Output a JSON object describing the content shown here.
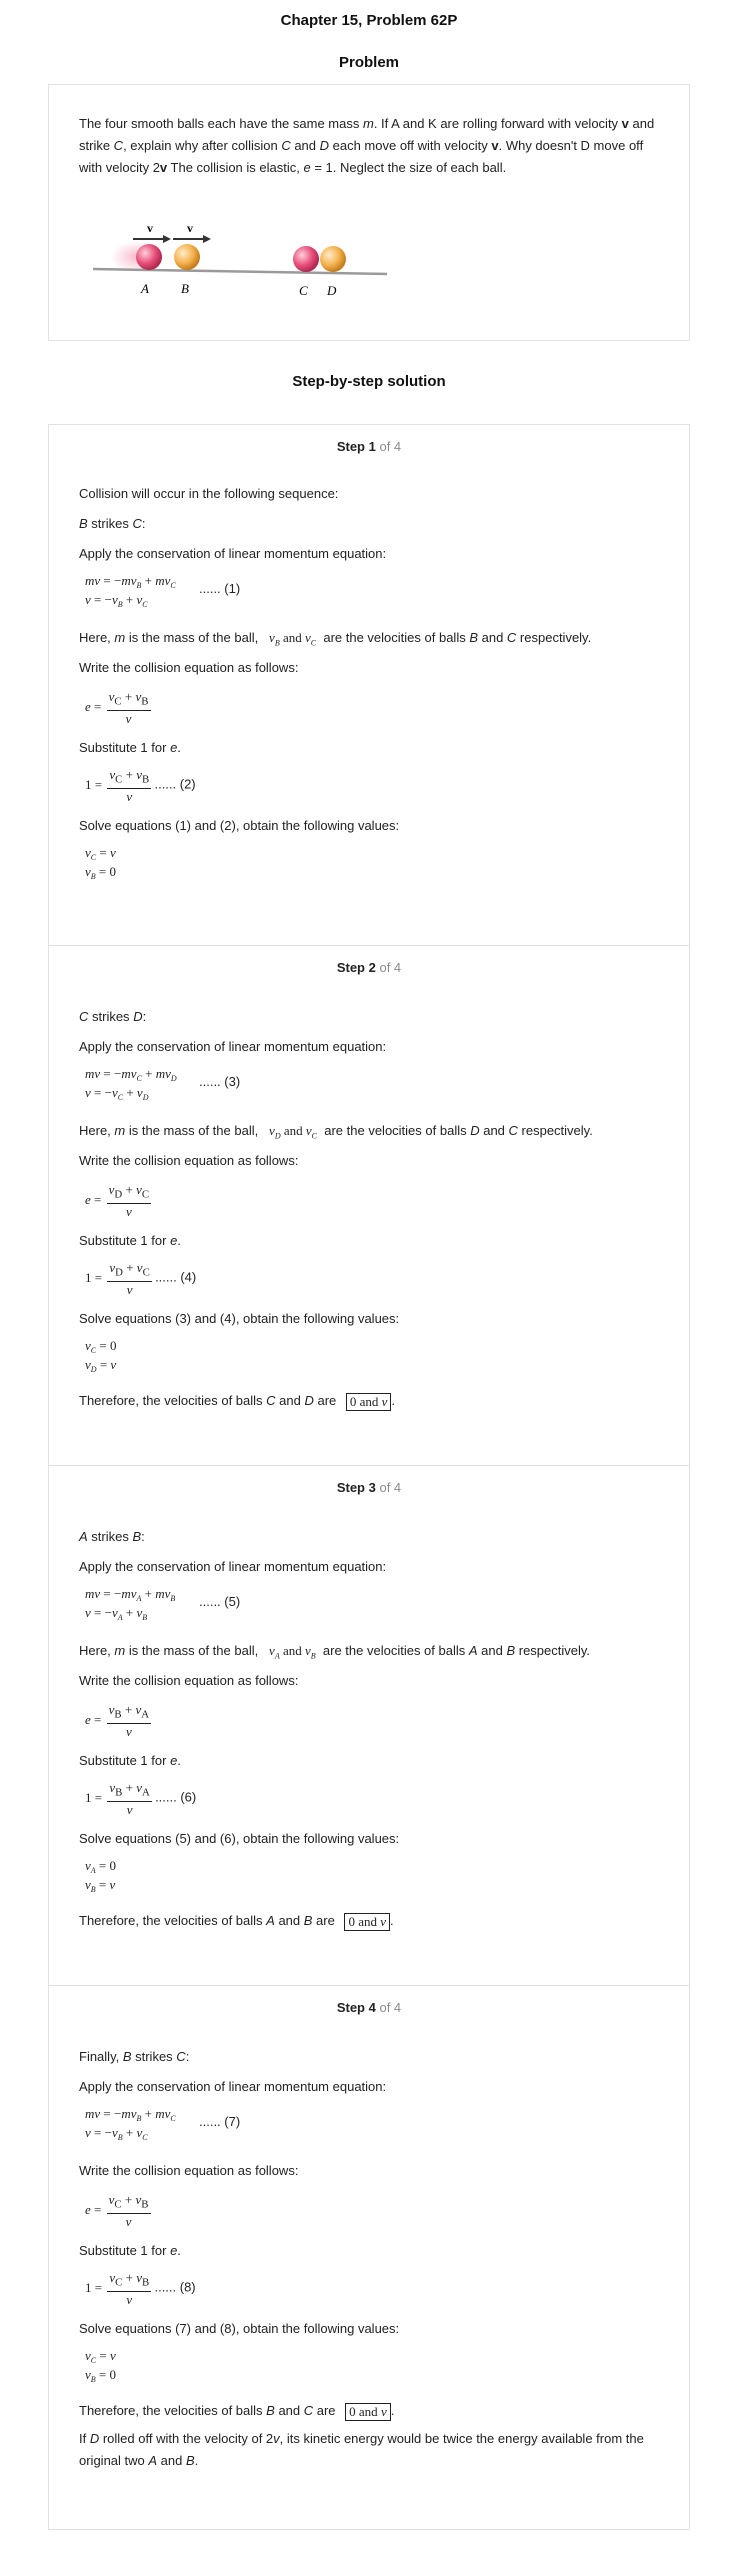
{
  "header": {
    "title": "Chapter 15, Problem 62P",
    "problem_heading": "Problem",
    "solution_heading": "Step-by-step solution"
  },
  "problem": {
    "text_html": "The four smooth balls each have the same mass <i>m</i>. If A and K are rolling forward with velocity <b>v</b> and strike <i>C</i>, explain why after collision <i>C</i> and <i>D</i> each move off with velocity <b>v</b>. Why doesn't D move off with velocity 2<b>v</b> The collision is elastic, <i>e</i> = 1. Neglect the size of each ball.",
    "figure": {
      "labels": [
        "v",
        "v",
        "A",
        "B",
        "C",
        "D"
      ],
      "colors": {
        "ball_a": "#e8507a",
        "ball_b": "#f5b24e",
        "ball_c": "#e8507a",
        "ball_d": "#f5b24e",
        "ground": "#9a9a9a"
      }
    }
  },
  "steps": [
    {
      "label": "Step 1",
      "of": "of 4",
      "lines": {
        "intro": "Collision will occur in the following sequence:",
        "strike": "B strikes C:",
        "momentum_intro": "Apply the conservation of linear momentum equation:",
        "here": "Here, m is the mass of the ball,   v_B and v_C  are the velocities of balls B and C respectively.",
        "collision_intro": "Write the collision equation as follows:",
        "substitute": "Substitute 1 for e.",
        "solve": "Solve equations (1) and (2), obtain the following values:"
      },
      "tags": {
        "eq1": "...... (1)",
        "eq2": "...... (2)"
      }
    },
    {
      "label": "Step 2",
      "of": "of 4",
      "lines": {
        "strike": "C strikes D:",
        "momentum_intro": "Apply the conservation of linear momentum equation:",
        "here": "Here, m is the mass of the ball,   v_D and v_C  are the velocities of balls D and C respectively.",
        "collision_intro": "Write the collision equation as follows:",
        "substitute": "Substitute 1 for e.",
        "solve": "Solve equations (3) and (4), obtain the following values:",
        "therefore": "Therefore, the velocities of balls C and D are",
        "answer": "0 and v"
      },
      "tags": {
        "eq1": "...... (3)",
        "eq2": "...... (4)"
      }
    },
    {
      "label": "Step 3",
      "of": "of 4",
      "lines": {
        "strike": "A strikes B:",
        "momentum_intro": "Apply the conservation of linear momentum equation:",
        "here": "Here, m is the mass of the ball,   v_A and v_B  are the velocities of balls A and B respectively.",
        "collision_intro": "Write the collision equation as follows:",
        "substitute": "Substitute 1 for e.",
        "solve": "Solve equations (5) and (6), obtain the following values:",
        "therefore": "Therefore, the velocities of balls A and B are",
        "answer": "0 and v"
      },
      "tags": {
        "eq1": "...... (5)",
        "eq2": "...... (6)"
      }
    },
    {
      "label": "Step 4",
      "of": "of 4",
      "lines": {
        "strike": "Finally, B strikes C:",
        "momentum_intro": "Apply the conservation of linear momentum equation:",
        "collision_intro": "Write the collision equation as follows:",
        "substitute": "Substitute 1 for e.",
        "solve": "Solve equations (7) and (8), obtain the following values:",
        "therefore": "Therefore, the velocities of balls B and C are",
        "answer": "0 and v",
        "closing": "If D rolled off with the velocity of 2v, its kinetic energy would be twice the energy available from the original two A and B."
      },
      "tags": {
        "eq1": "...... (7)",
        "eq2": "...... (8)"
      }
    }
  ]
}
